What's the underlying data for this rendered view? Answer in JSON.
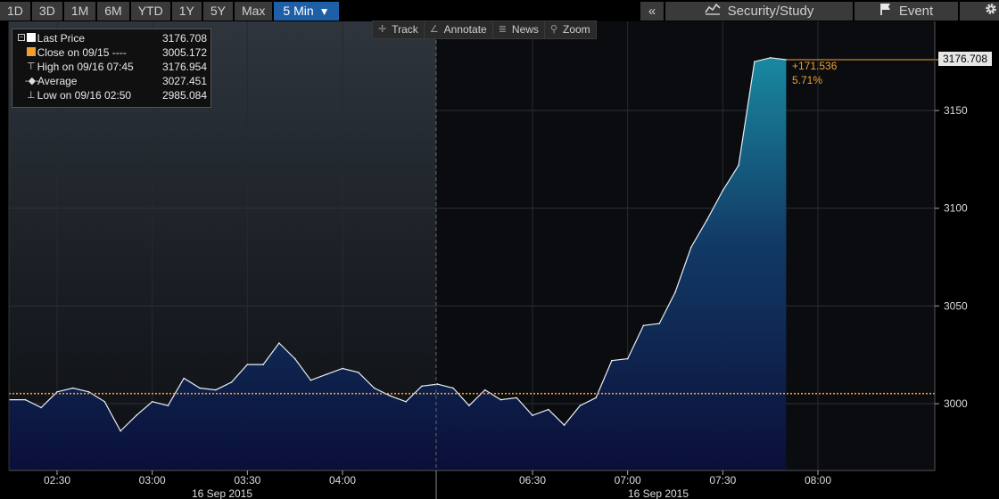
{
  "toolbar": {
    "ranges": [
      "1D",
      "3D",
      "1M",
      "6M",
      "YTD",
      "1Y",
      "5Y",
      "Max"
    ],
    "interval": "5 Min",
    "collapse": "«",
    "security_study": "Security/Study",
    "event": "Event"
  },
  "chart_tools": {
    "track": "Track",
    "annotate": "Annotate",
    "news": "News",
    "zoom": "Zoom"
  },
  "legend": {
    "rows": [
      {
        "label": "Last Price",
        "value": "3176.708"
      },
      {
        "label": "Close on 09/15 ----",
        "value": "3005.172"
      },
      {
        "label": "High on 09/16 07:45",
        "value": "3176.954"
      },
      {
        "label": "Average",
        "value": "3027.451"
      },
      {
        "label": "Low on 09/16 02:50",
        "value": "2985.084"
      }
    ]
  },
  "annotations": {
    "last_price_tag": "3176.708",
    "change_abs": "+171.536",
    "change_pct": "5.71%"
  },
  "colors": {
    "close_line": "#f0a030",
    "area_top": "#1a8fa8",
    "area_bottom": "#0a0f3a",
    "active_button": "#1f5fa8"
  },
  "chart_data": {
    "type": "area",
    "ylim": [
      2970,
      3190
    ],
    "yticks": [
      "3000",
      "3050",
      "3100",
      "3150"
    ],
    "xticks": [
      "02:30",
      "03:00",
      "03:30",
      "04:00",
      "06:30",
      "07:00",
      "07:30",
      "08:00"
    ],
    "date_labels": [
      "16 Sep 2015",
      "16 Sep 2015"
    ],
    "close_level": 3005.172,
    "series": [
      {
        "x": [
          "02:20",
          "02:25",
          "02:30",
          "02:35",
          "02:40",
          "02:45",
          "02:50",
          "02:55",
          "03:00",
          "03:05",
          "03:10",
          "03:15",
          "03:20",
          "03:25",
          "03:30",
          "03:35",
          "03:40",
          "03:45",
          "03:50",
          "03:55",
          "04:00",
          "04:05",
          "04:10",
          "04:15",
          "04:20",
          "04:25",
          "04:30",
          "06:00",
          "06:05",
          "06:10",
          "06:15",
          "06:20",
          "06:25",
          "06:30",
          "06:35",
          "06:40",
          "06:45",
          "06:50",
          "06:55",
          "07:00",
          "07:05",
          "07:10",
          "07:15",
          "07:20",
          "07:25",
          "07:30",
          "07:35",
          "07:40",
          "07:45",
          "07:50"
        ],
        "values": [
          3002,
          2998,
          3006,
          3008,
          3006,
          3001,
          2986,
          2994,
          3001,
          2999,
          3013,
          3008,
          3007,
          3011,
          3020,
          3020,
          3031,
          3023,
          3012,
          3015,
          3018,
          3016,
          3008,
          3004,
          3001,
          3009,
          3010,
          3010,
          3008,
          2999,
          3007,
          3002,
          3003,
          2994,
          2997,
          2989,
          2999,
          3003,
          3022,
          3023,
          3040,
          3041,
          3057,
          3080,
          3094,
          3109,
          3122,
          3175,
          3177,
          3176
        ]
      }
    ]
  }
}
